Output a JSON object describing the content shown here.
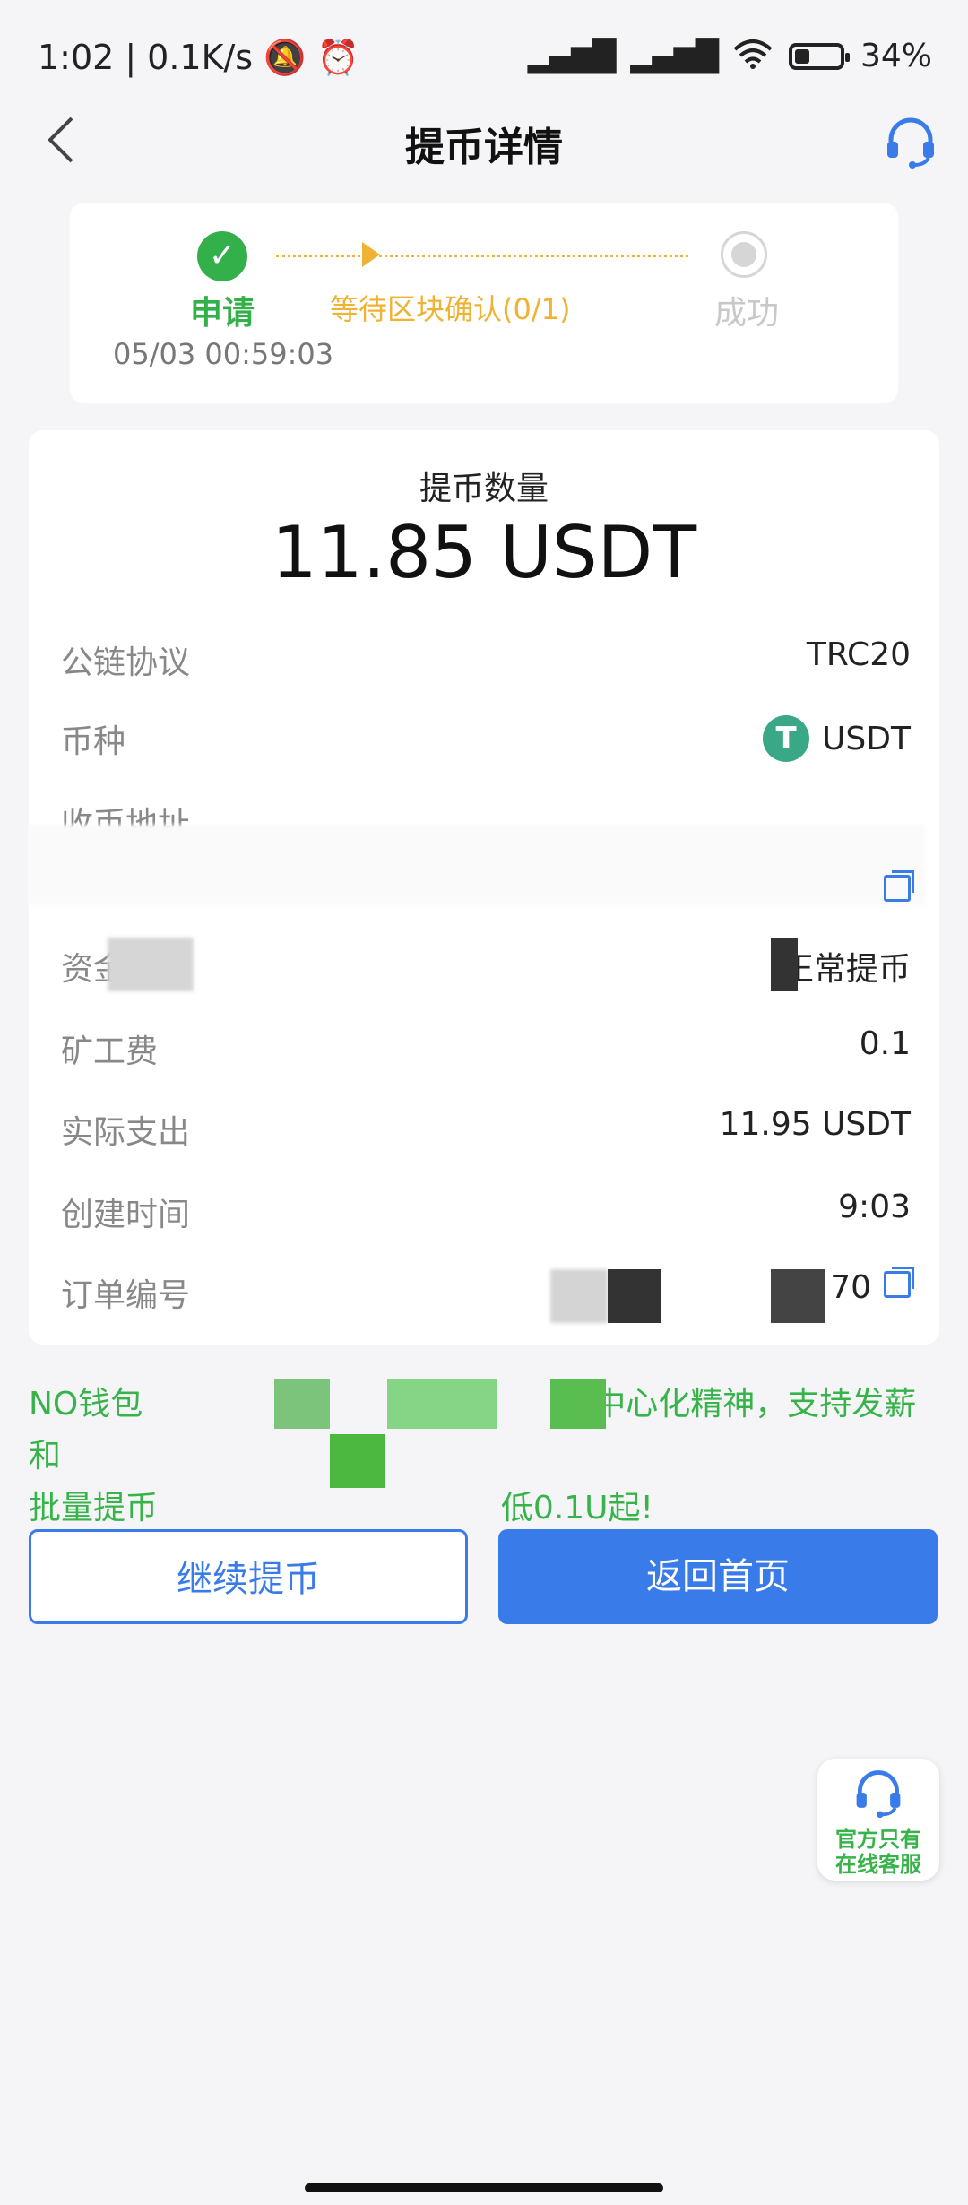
{
  "status": {
    "time": "1:02",
    "speed": "0.1K/s",
    "battery": "34%",
    "battery_level": 0.34
  },
  "header": {
    "title": "提币详情"
  },
  "progress": {
    "step1_label": "申请",
    "step1_time": "05/03 00:59:03",
    "step2_label": "等待区块确认(0/1)",
    "step3_label": "成功"
  },
  "detail": {
    "amount_label": "提币数量",
    "amount_value": "11.85 USDT",
    "rows": [
      {
        "label": "公链协议",
        "value": "TRC20"
      },
      {
        "label": "币种",
        "value": "USDT"
      },
      {
        "label": "收币地址",
        "value": ""
      },
      {
        "label": "资金类型",
        "value": "正常提币"
      },
      {
        "label": "矿工费",
        "value": "0.1"
      },
      {
        "label": "实际支出",
        "value": "11.95 USDT"
      },
      {
        "label": "创建时间",
        "value": "9:03"
      },
      {
        "label": "订单编号",
        "value": "70"
      }
    ],
    "coin_symbol": "T"
  },
  "notice": {
    "line1_a": "NO钱包",
    "line1_b": "中心化精神，支持发薪和",
    "line2_a": "批量提币",
    "line2_b": "低0.1U起!"
  },
  "buttons": {
    "continue": "继续提币",
    "home": "返回首页"
  },
  "service": {
    "line1": "官方只有",
    "line2": "在线客服"
  },
  "colors": {
    "accent": "#3a7bea",
    "success": "#34b04a",
    "pending": "#f0b232",
    "usdt": "#3aa886"
  }
}
